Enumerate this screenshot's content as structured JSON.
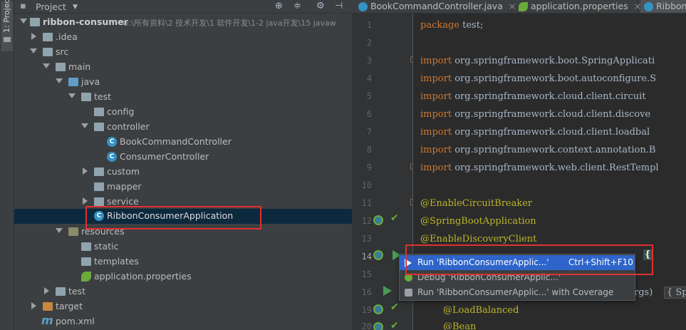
{
  "strip": {
    "label": "1: Project"
  },
  "project_panel": {
    "title": "Project",
    "root": {
      "name": "ribbon-consumer",
      "path": "G:\\所有资料\\2 技术开发\\1 软件开发\\1-2 java开发\\15 javaw"
    },
    "items": [
      {
        "label": ".idea"
      },
      {
        "label": "src"
      },
      {
        "label": "main"
      },
      {
        "label": "java"
      },
      {
        "label": "test"
      },
      {
        "label": "config"
      },
      {
        "label": "controller"
      },
      {
        "label": "BookCommandController"
      },
      {
        "label": "ConsumerController"
      },
      {
        "label": "custom"
      },
      {
        "label": "mapper"
      },
      {
        "label": "service"
      },
      {
        "label": "RibbonConsumerApplication"
      },
      {
        "label": "resources"
      },
      {
        "label": "static"
      },
      {
        "label": "templates"
      },
      {
        "label": "application.properties"
      },
      {
        "label": "test"
      },
      {
        "label": "target"
      },
      {
        "label": "pom.xml"
      }
    ]
  },
  "editor": {
    "tabs": [
      {
        "label": "BookCommandController.java"
      },
      {
        "label": "application.properties"
      },
      {
        "label": "Ribbon"
      }
    ],
    "line_numbers": [
      "1",
      "2",
      "3",
      "4",
      "5",
      "6",
      "7",
      "8",
      "9",
      "10",
      "11",
      "12",
      "13",
      "14",
      "15",
      "16",
      "19",
      "20"
    ],
    "code": {
      "l1_kw": "package",
      "l1_rest": " test;",
      "imports": [
        "org.springframework.boot.SpringApplicati",
        "org.springframework.boot.autoconfigure.S",
        "org.springframework.cloud.client.circuit",
        "org.springframework.cloud.client.discove",
        "org.springframework.cloud.client.loadbal",
        "org.springframework.context.annotation.B",
        "org.springframework.web.client.RestTempl"
      ],
      "import_kw": "import",
      "ann1": "@EnableCircuitBreaker",
      "ann2": "@SpringBootApplication",
      "ann3": "@EnableDiscoveryClient",
      "l14_frag": "{",
      "l16_frag": "rgs)",
      "l16_brace": "{ Sp",
      "ann19": "@LoadBalanced",
      "ann20": "@Bean"
    }
  },
  "popup": {
    "items": [
      {
        "label": "Run 'RibbonConsumerApplic...'",
        "shortcut": "Ctrl+Shift+F10"
      },
      {
        "label": "Debug 'RibbonConsumerApplic...'"
      },
      {
        "label": "Run 'RibbonConsumerApplic...' with Coverage"
      }
    ]
  },
  "colors": {
    "highlight_box": "#e03030",
    "selection": "#0d293e",
    "menu_active": "#2f65ca"
  }
}
